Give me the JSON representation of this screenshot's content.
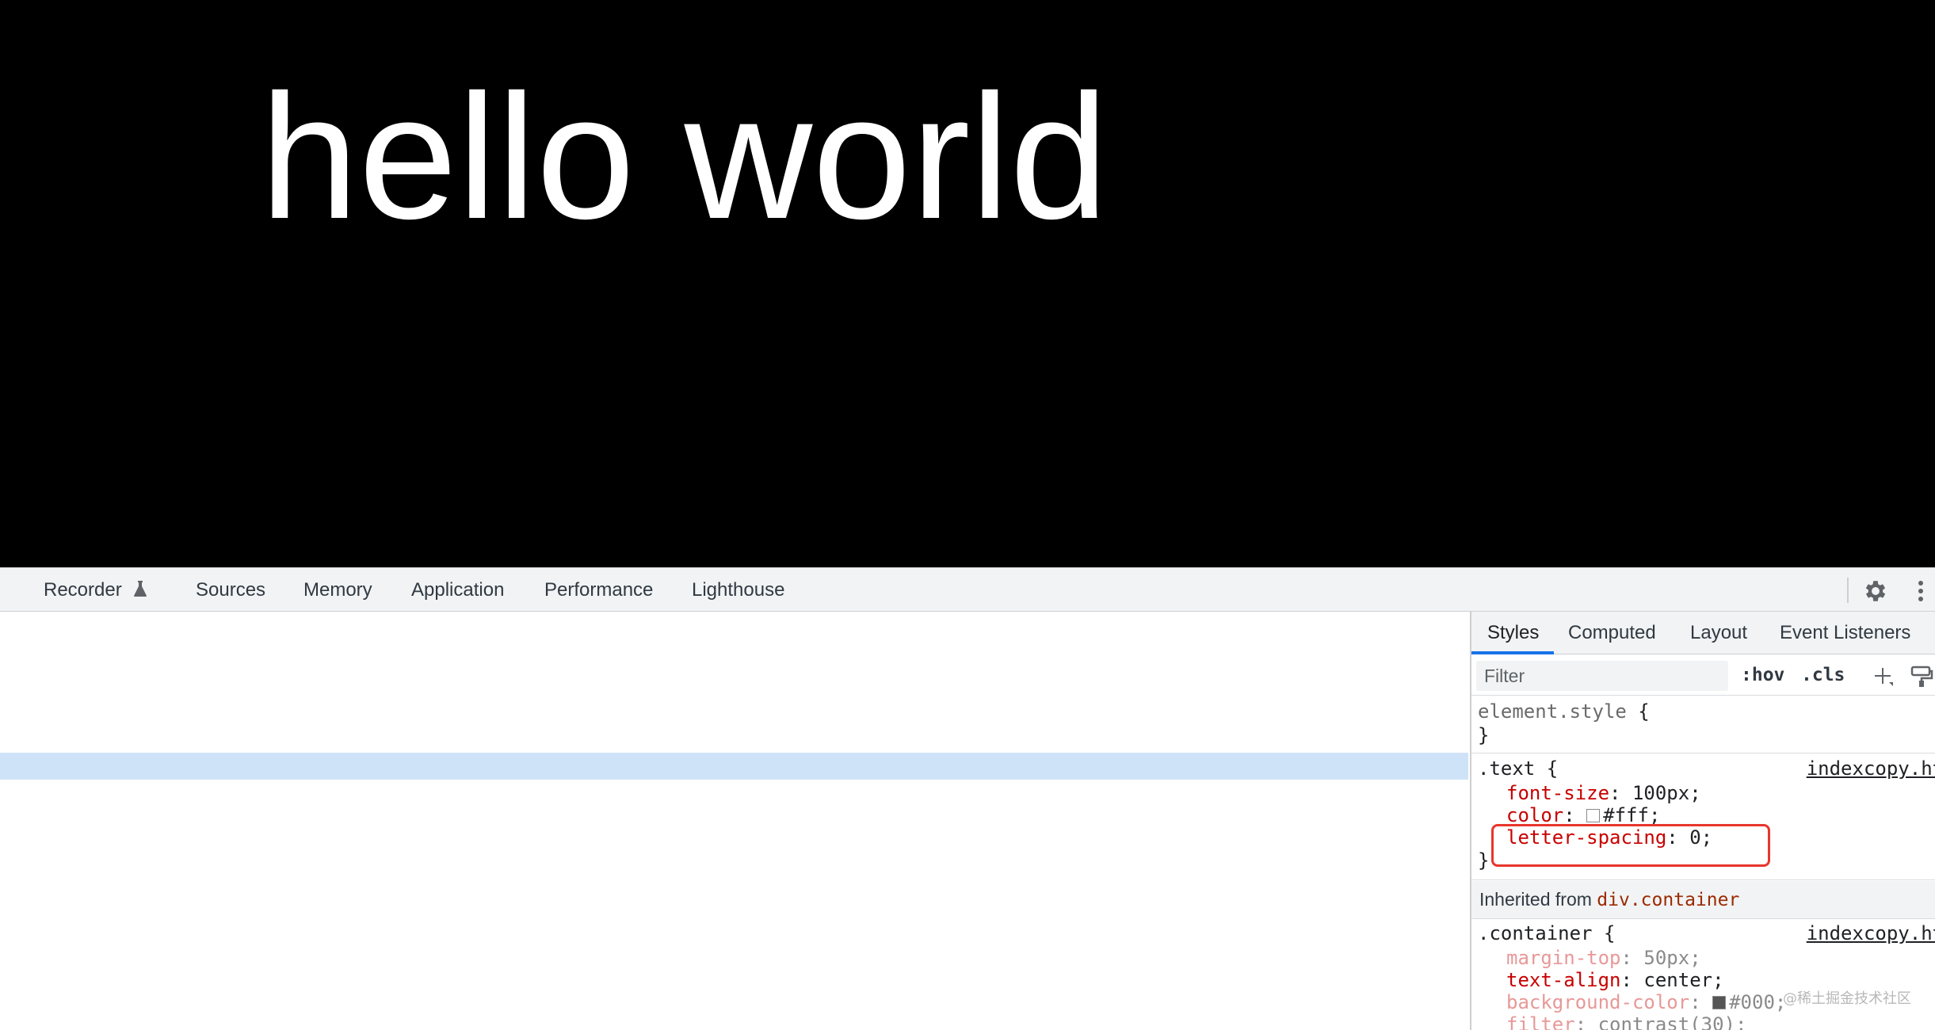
{
  "page": {
    "text": "hello world"
  },
  "devtools": {
    "tabs": [
      {
        "label": "Recorder"
      },
      {
        "label": "Sources"
      },
      {
        "label": "Memory"
      },
      {
        "label": "Application"
      },
      {
        "label": "Performance"
      },
      {
        "label": "Lighthouse"
      }
    ],
    "icons": {
      "recorder": "flask-icon",
      "settings": "gear-icon",
      "more": "kebab-menu-icon"
    }
  },
  "styles_panel": {
    "subtabs": [
      {
        "label": "Styles",
        "active": true
      },
      {
        "label": "Computed"
      },
      {
        "label": "Layout"
      },
      {
        "label": "Event Listeners"
      }
    ],
    "filter_placeholder": "Filter",
    "hov": ":hov",
    "cls": ".cls",
    "element_style": {
      "selector": "element.style",
      "open": "{",
      "close": "}"
    },
    "text_rule": {
      "selector": ".text",
      "open": "{",
      "close": "}",
      "source": "indexcopy.html",
      "props": [
        {
          "name": "font-size",
          "value": "100px;"
        },
        {
          "name": "color",
          "value": "#fff;",
          "swatch": "#ffffff"
        },
        {
          "name": "letter-spacing",
          "value": "0;"
        }
      ]
    },
    "inherited": {
      "label": "Inherited from",
      "selector": "div.container"
    },
    "container_rule": {
      "selector": ".container",
      "open": "{",
      "source": "indexcopy.html",
      "props": [
        {
          "name": "margin-top",
          "value": "50px;",
          "overridden": true
        },
        {
          "name": "text-align",
          "value": "center;"
        },
        {
          "name": "background-color",
          "value": "#000;",
          "swatch": "#000000",
          "overridden": true
        },
        {
          "name": "filter",
          "value": "contrast(30);",
          "overridden": true
        }
      ]
    },
    "watermark": "@稀土掘金技术社区"
  },
  "colors": {
    "highlight_box": "#e8362c",
    "selected_row": "#cfe3f8",
    "accent": "#1a73e8"
  }
}
